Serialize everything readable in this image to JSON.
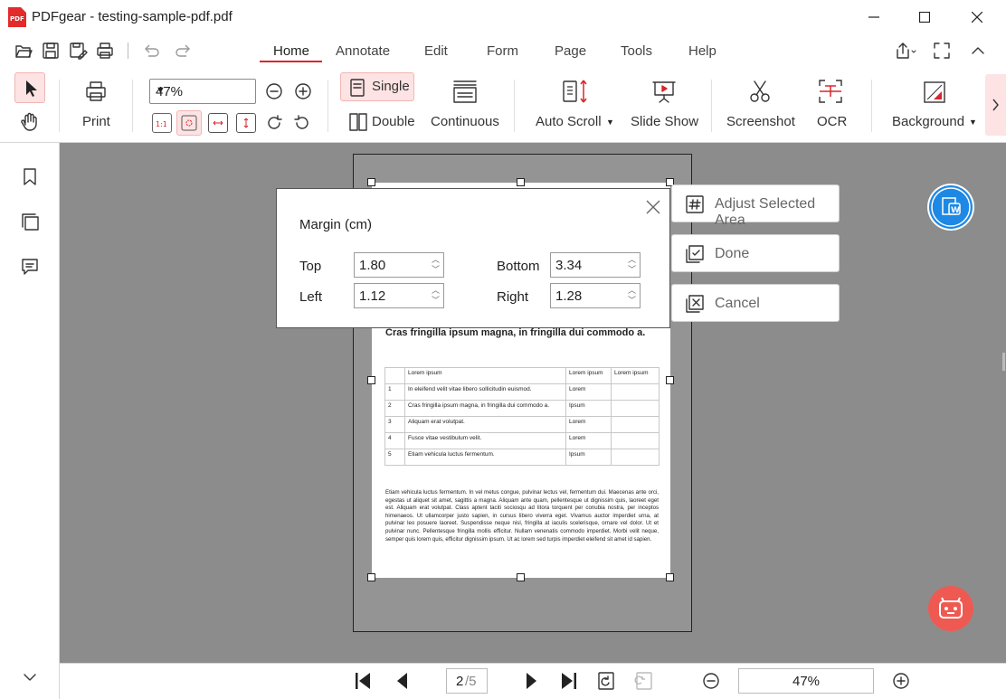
{
  "window": {
    "title": "PDFgear - testing-sample-pdf.pdf",
    "logo_text": "PDF"
  },
  "menu": {
    "tabs": [
      "Home",
      "Annotate",
      "Edit",
      "Form",
      "Page",
      "Tools",
      "Help"
    ],
    "active_tab": "Home"
  },
  "ribbon": {
    "print": "Print",
    "zoom": "47%",
    "single": "Single",
    "double": "Double",
    "continuous": "Continuous",
    "auto_scroll": "Auto Scroll",
    "slide_show": "Slide Show",
    "screenshot": "Screenshot",
    "ocr": "OCR",
    "background": "Background",
    "actual_size_icon_text": "1:1"
  },
  "dialog": {
    "title": "Margin (cm)",
    "top_label": "Top",
    "top_value": "1.80",
    "left_label": "Left",
    "left_value": "1.12",
    "bottom_label": "Bottom",
    "bottom_value": "3.34",
    "right_label": "Right",
    "right_value": "1.28"
  },
  "actions": {
    "adjust": "Adjust Selected Area",
    "done": "Done",
    "cancel": "Cancel"
  },
  "document": {
    "heading": "Cras fringilla ipsum magna, in fringilla dui commodo a.",
    "table_header": [
      "",
      "Lorem ipsum",
      "Lorem ipsum",
      "Lorem ipsum"
    ],
    "table_rows": [
      [
        "1",
        "In eleifend velit vitae libero sollicitudin euismod.",
        "Lorem",
        ""
      ],
      [
        "2",
        "Cras fringilla ipsum magna, in fringilla dui commodo a.",
        "Ipsum",
        ""
      ],
      [
        "3",
        "Aliquam erat volutpat.",
        "Lorem",
        ""
      ],
      [
        "4",
        "Fusce vitae vestibulum velit.",
        "Lorem",
        ""
      ],
      [
        "5",
        "Etiam vehicula luctus fermentum.",
        "Ipsum",
        ""
      ]
    ],
    "paragraph": "Etiam vehicula luctus fermentum. In vel metus congue, pulvinar lectus vel, fermentum dui. Maecenas ante orci, egestas ut aliquet sit amet, sagittis a magna. Aliquam ante quam, pellentesque ut dignissim quis, laoreet eget est. Aliquam erat volutpat. Class aptent taciti sociosqu ad litora torquent per conubia nostra, per inceptos himenaeos. Ut ullamcorper justo sapien, in cursus libero viverra eget. Vivamus auctor imperdiet urna, at pulvinar leo posuere laoreet. Suspendisse neque nisl, fringilla at iaculis scelerisque, ornare vel dolor. Ut et pulvinar nunc. Pellentesque fringilla mollis efficitur. Nullam venenatis commodo imperdiet. Morbi velit neque, semper quis lorem quis, efficitur dignissim ipsum. Ut ac lorem sed turpis imperdiet eleifend sit amet id sapien."
  },
  "navigation": {
    "current_page": "2",
    "total_pages": "/5",
    "zoom": "47%"
  },
  "colors": {
    "accent": "#d9262a",
    "canvas": "#8c8c8c",
    "word_badge": "#1e88e5",
    "assistant_badge": "#ee5a52"
  }
}
